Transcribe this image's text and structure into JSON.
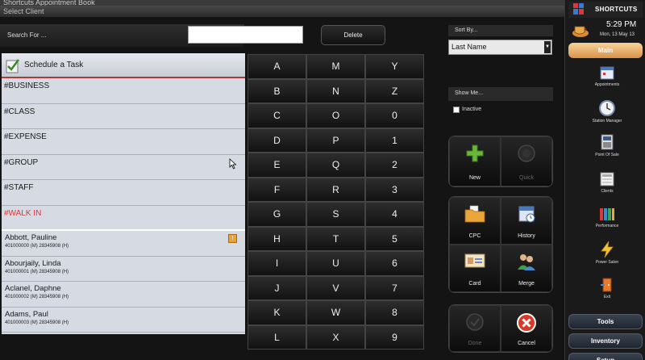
{
  "window": {
    "top_strip_text": "Shortcuts Appointment Book",
    "title": "Select Client",
    "corner_glyph": "↗"
  },
  "search": {
    "label": "Search For ...",
    "value": "",
    "delete_label": "Delete"
  },
  "list": {
    "task_label": "Schedule a Task",
    "categories": [
      "#BUSINESS",
      "#CLASS",
      "#EXPENSE",
      "#GROUP",
      "#STAFF",
      "#WALK IN"
    ],
    "clients": [
      {
        "name": "Abbott, Pauline",
        "sub": "401000000 (M) 28345908 (H)",
        "flag": "!"
      },
      {
        "name": "Abourjaily, Linda",
        "sub": "401000001 (M) 28345908 (H)"
      },
      {
        "name": "Aclanel, Daphne",
        "sub": "401000002 (M) 28345908 (H)"
      },
      {
        "name": "Adams, Paul",
        "sub": "401000003 (M) 28345908 (H)"
      }
    ]
  },
  "keypad": {
    "keys": [
      "A",
      "M",
      "Y",
      "B",
      "N",
      "Z",
      "C",
      "O",
      "0",
      "D",
      "P",
      "1",
      "E",
      "Q",
      "2",
      "F",
      "R",
      "3",
      "G",
      "S",
      "4",
      "H",
      "T",
      "5",
      "I",
      "U",
      "6",
      "J",
      "V",
      "7",
      "K",
      "W",
      "8",
      "L",
      "X",
      "9"
    ]
  },
  "sort": {
    "label": "Sort By...",
    "selected": "Last Name",
    "arrow": "▼"
  },
  "show": {
    "label": "Show Me...",
    "inactive_label": "Inactive"
  },
  "actions": {
    "new": "New",
    "quick": "Quick",
    "cpc": "CPC",
    "history": "History",
    "card": "Card",
    "merge": "Merge",
    "done": "Done",
    "cancel": "Cancel"
  },
  "sidebar": {
    "brand": "SHORTCUTS",
    "time": "5:29 PM",
    "date": "Mon, 13 May 13",
    "main_tab": "Main",
    "items": [
      "Appointments",
      "Station Manager",
      "Point Of Sale",
      "Clients",
      "Performance",
      "Power Salon",
      "Exit"
    ],
    "tabs": [
      "Tools",
      "Inventory",
      "Setup"
    ]
  },
  "colors": {
    "accent_orange": "#d9924a",
    "walkin_red": "#d83a3a",
    "list_bg": "#d5dae3"
  }
}
